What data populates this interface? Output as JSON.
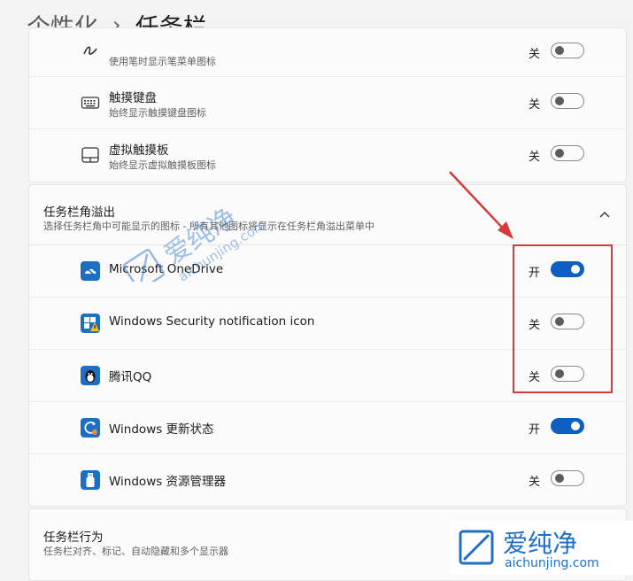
{
  "header": {
    "parent": "个性化",
    "separator": "›",
    "current": "任务栏"
  },
  "colors": {
    "accent": "#0f5fc2",
    "highlight_box": "#d63a3a",
    "watermark": "#2f78c8"
  },
  "taskbar_corner_icons": [
    {
      "title": "",
      "desc": "使用笔时显示笔菜单图标",
      "state": "关",
      "on": false,
      "icon": "pen-icon"
    },
    {
      "title": "触摸键盘",
      "desc": "始终显示触摸键盘图标",
      "state": "关",
      "on": false,
      "icon": "keyboard-icon"
    },
    {
      "title": "虚拟触摸板",
      "desc": "始终显示虚拟触摸板图标",
      "state": "关",
      "on": false,
      "icon": "touchpad-icon"
    }
  ],
  "overflow": {
    "title": "任务栏角溢出",
    "subtitle": "选择任务栏角中可能显示的图标 - 所有其他图标将显示在任务栏角溢出菜单中",
    "items": [
      {
        "label": "Microsoft OneDrive",
        "state": "开",
        "on": true,
        "icon": "onedrive-icon"
      },
      {
        "label": "Windows Security notification icon",
        "state": "关",
        "on": false,
        "icon": "windows-security-icon"
      },
      {
        "label": "腾讯QQ",
        "state": "关",
        "on": false,
        "icon": "qq-icon"
      },
      {
        "label": "Windows 更新状态",
        "state": "开",
        "on": true,
        "icon": "windows-update-icon"
      },
      {
        "label": "Windows 资源管理器",
        "state": "关",
        "on": false,
        "icon": "usb-drive-icon"
      }
    ]
  },
  "behaviors": {
    "title": "任务栏行为",
    "subtitle": "任务栏对齐、标记、自动隐藏和多个显示器"
  },
  "watermark": {
    "brand": "爱纯净",
    "domain": "aichunjing.com"
  }
}
